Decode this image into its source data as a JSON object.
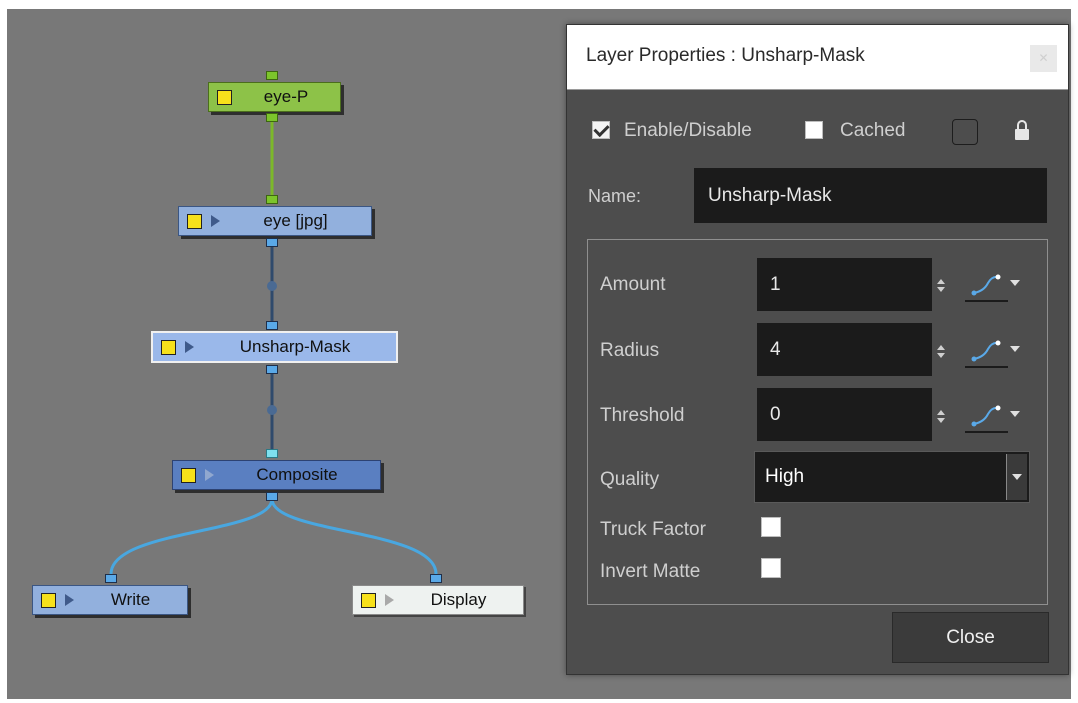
{
  "node_view": {
    "nodes": {
      "eye_p": "eye-P",
      "eye_jpg": "eye  [jpg]",
      "unsharp": "Unsharp-Mask",
      "composite": "Composite",
      "write": "Write",
      "display": "Display"
    },
    "colors": {
      "background": "#787878",
      "wire_green": "#7cb82a",
      "wire_dark": "#2f4a6c",
      "wire_blue": "#49a7e0"
    }
  },
  "dialog": {
    "title": "Layer Properties : Unsharp-Mask",
    "enable_label": "Enable/Disable",
    "enable_checked": true,
    "cached_label": "Cached",
    "cached_checked": false,
    "name_label": "Name:",
    "name_value": "Unsharp-Mask",
    "params": [
      {
        "label": "Amount",
        "value": "1"
      },
      {
        "label": "Radius",
        "value": "4"
      },
      {
        "label": "Threshold",
        "value": "0"
      }
    ],
    "quality_label": "Quality",
    "quality_value": "High",
    "truck_factor_label": "Truck Factor",
    "truck_factor_checked": false,
    "invert_matte_label": "Invert Matte",
    "invert_matte_checked": false,
    "close_label": "Close",
    "icons": [
      "lock-icon",
      "function-curve-icon",
      "color-swatch"
    ]
  }
}
